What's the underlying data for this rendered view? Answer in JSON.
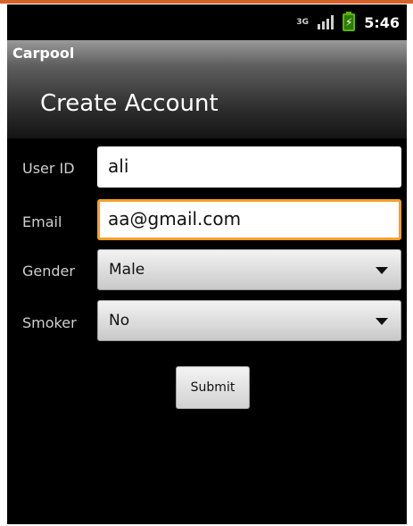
{
  "status": {
    "network": "3G",
    "time": "5:46"
  },
  "app": {
    "title": "Carpool"
  },
  "screen": {
    "heading": "Create Account"
  },
  "form": {
    "userid": {
      "label": "User ID",
      "value": "ali"
    },
    "email": {
      "label": "Email",
      "value": "aa@gmail.com"
    },
    "gender": {
      "label": "Gender",
      "value": "Male"
    },
    "smoker": {
      "label": "Smoker",
      "value": "No"
    },
    "submit_label": "Submit"
  },
  "colors": {
    "focus_border": "#f5a026",
    "accent_line": "#d9622a",
    "battery": "#5fb300"
  }
}
